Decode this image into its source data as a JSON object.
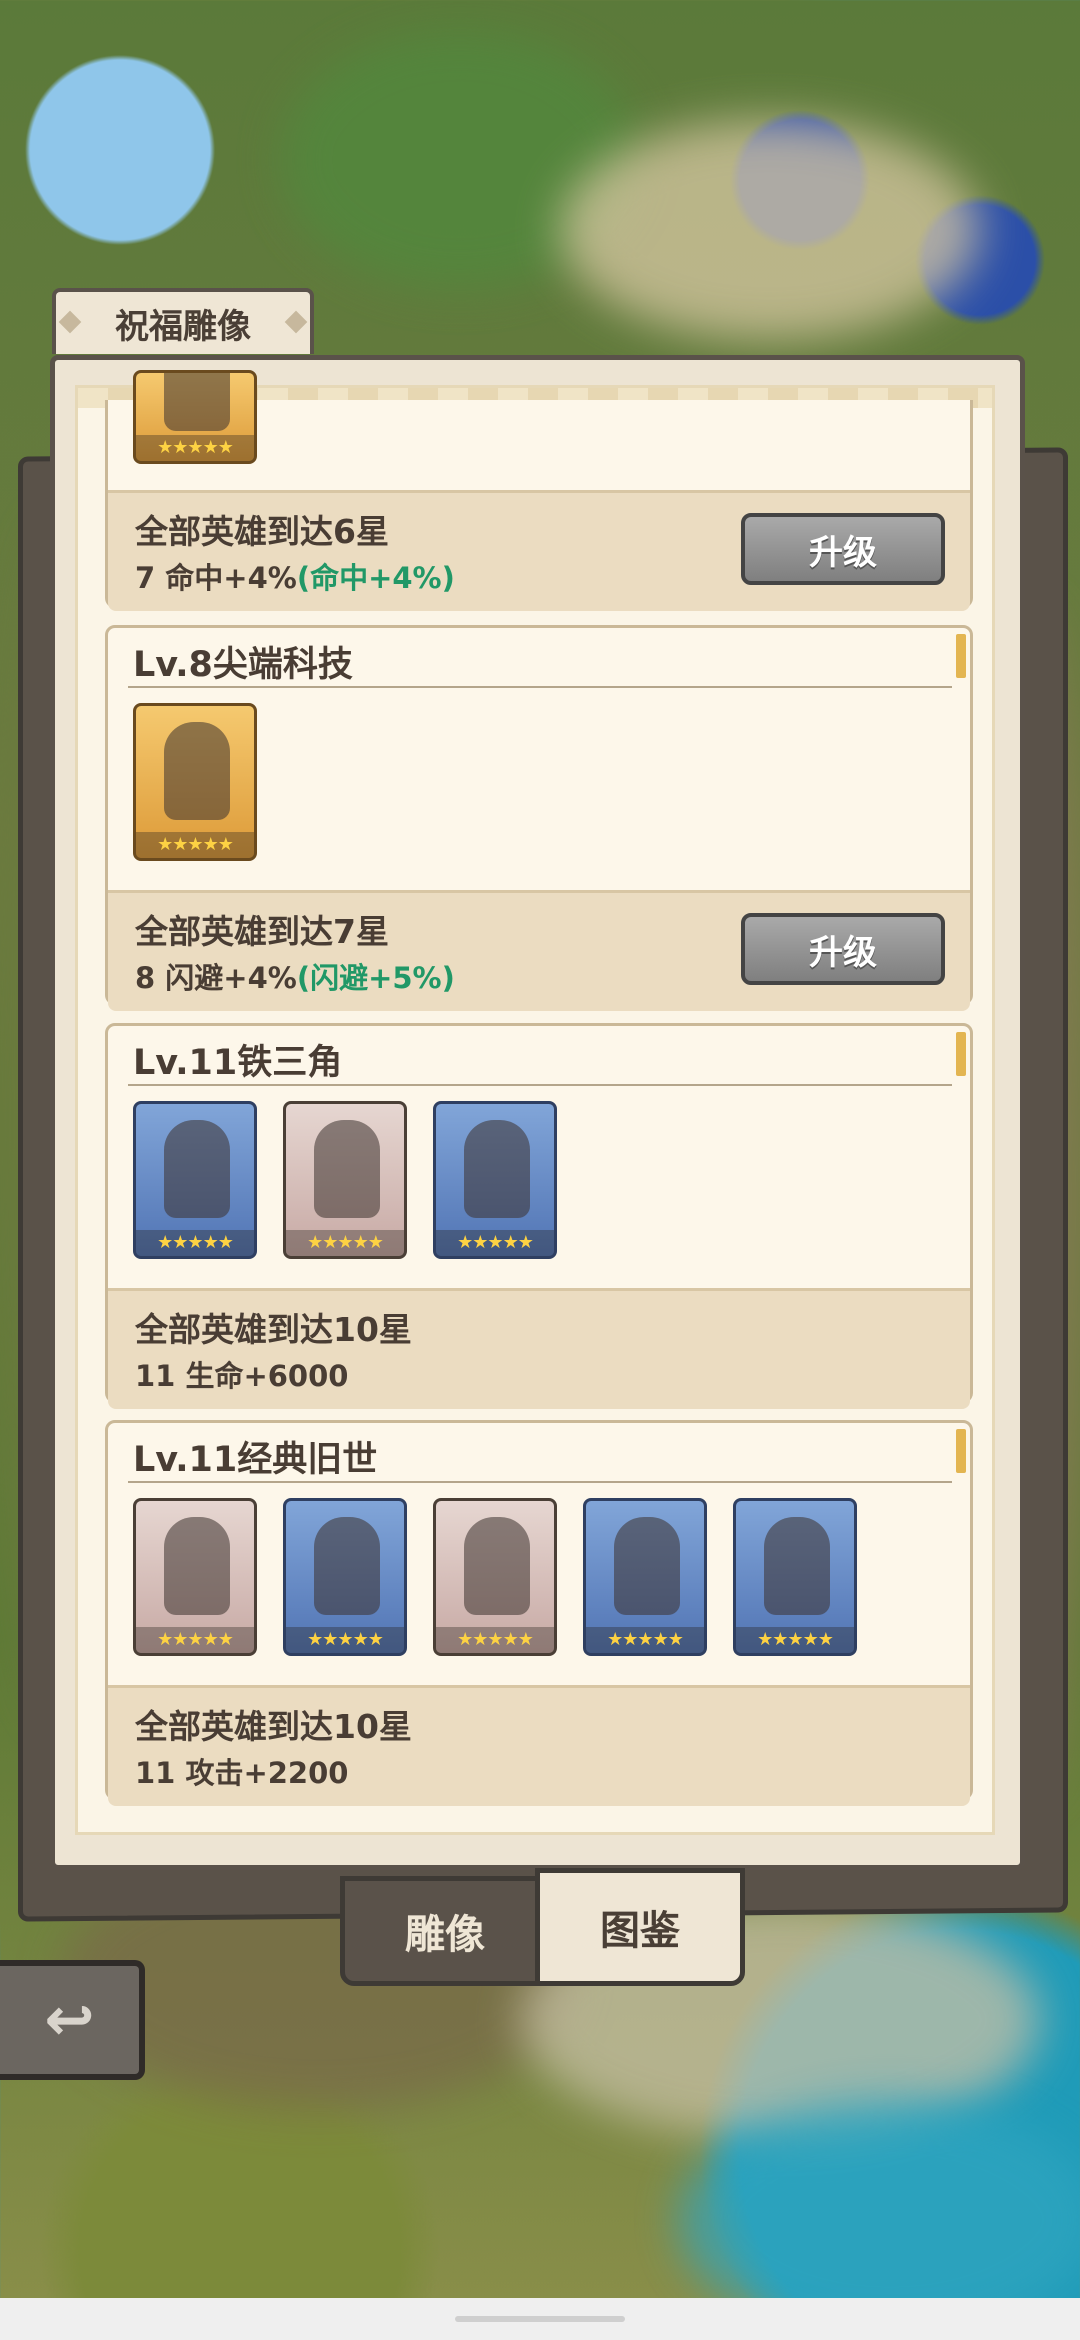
{
  "window": {
    "title": "祝福雕像"
  },
  "cards": [
    {
      "title": "",
      "hero_count": 1,
      "requirement": "全部英雄到达6星",
      "stat_main": "7 命中+4%",
      "stat_bonus": "(命中+4%)",
      "button": "升级"
    },
    {
      "title": "Lv.8尖端科技",
      "requirement": "全部英雄到达7星",
      "stat_main": "8 闪避+4%",
      "stat_bonus": "(闪避+5%)",
      "button": "升级"
    },
    {
      "title": "Lv.11铁三角",
      "requirement": "全部英雄到达10星",
      "stat_main": "11 生命+6000",
      "stat_bonus": ""
    },
    {
      "title": "Lv.11经典旧世",
      "requirement": "全部英雄到达10星",
      "stat_main": "11 攻击+2200",
      "stat_bonus": ""
    }
  ],
  "stars": "★★★★★",
  "tabs": {
    "statue": "雕像",
    "codex": "图鉴"
  },
  "back_icon": "↩"
}
